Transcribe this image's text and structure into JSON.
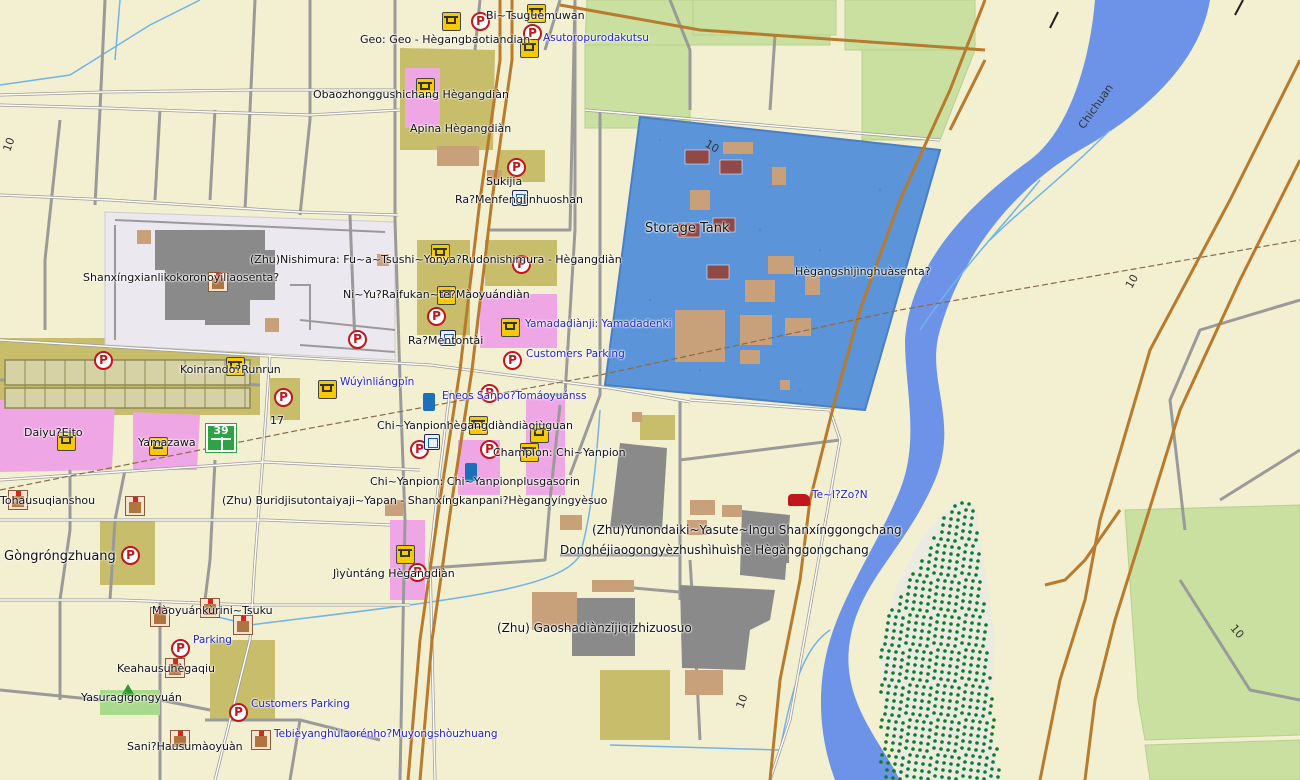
{
  "map": {
    "colors": {
      "land": "#f3efd1",
      "water": "#6c93e8",
      "storage_area": "#5b94d8",
      "farmland": "#c9e0a0",
      "commercial": "#efa6e4",
      "industrial": "#c7bd6b",
      "road": "#ffffff",
      "major_road": "#b87a2c",
      "building": "#c8a07a",
      "factory": "#8a8a8a",
      "forest_dots": "#0c7b2c"
    },
    "labels": {
      "bi_tsuguemuwan": "Bi~Tsuguemuwan",
      "geo_hegang": "Geo: Geo - Hègangbaotiandian",
      "asutoro": "Asutoropurodakutsu",
      "obaoz": "Obaozhonggushichang Hègangdiàn",
      "apina": "Apina Hègangdiàn",
      "sukijia": "Sukijia",
      "ramenfeng": "Ra?Menfenglinhuoshan",
      "storage_tank": "Storage Tank",
      "hegangshiji": "Hègangshìjìnghuàsenta?",
      "shanxing_center": "Shanxíngxianlikokoronoyiliaosenta?",
      "nishimura": "(Zhu)Nishimura: Fu~a~Tsushi~Yonya?Rudonishimura - Hègangdiàn",
      "raifukan": "Ni~Yu?Raifukan~te?Màoyuándiàn",
      "yamada": "Yamadadiànji: Yamadadenki",
      "ramentai": "Ra?Mentontài",
      "customers_parking_1": "Customers Parking",
      "koinrando": "Koinrando?Runrun",
      "wuyinliangpin": "Wúyìnliángpǐn",
      "eneos": "Eneos Sanpo?Tomáoyuánss",
      "daiyu": "Daiyu?Eito",
      "yamazawa": "Yamazawa",
      "road_17": "17",
      "chi_yanpion_hegang": "Chi~Yanpionhègangdiàndiàojùguan",
      "champion": "Champion: Chi~Yanpion",
      "chi_plus": "Chi~Yanpion: Chi~Yanpionplusgasorin",
      "tohausu": "Tohausuqianshou",
      "buridjisu": "(Zhu) Buridjisutontaiyaji~Yapan - Shanxíngkanpani?Hègangyíngyèsuo",
      "yunion": "(Zhu)Yunondaiki~Yasute~Ingu Shanxínggongchang",
      "donghe": "Donghéjiaogongyèzhushìhuìshè Hègànggongchang",
      "te_izon": "Te~I?Zo?N",
      "gongrong": "Gòngróngzhuang",
      "jiyuntang": "Jìyùntáng Hègangdiàn",
      "maoyuan": "Màoyuánkùrini~Tsuku",
      "parking": "Parking",
      "gaoshadian": "(Zhu) Gaoshadiànzǐjiqizhizuosuo",
      "keahausu": "Keahausuhègaqiu",
      "yasura": "Yasuragigongyuán",
      "customers_parking_2": "Customers Parking",
      "tebie": "Tebièyanghùlaorénho?Muyongshòuzhuang",
      "sani": "Sani?Hausumàoyuàn",
      "chichuan": "Chichuan",
      "route_39": "39",
      "contour_10": "10"
    }
  }
}
